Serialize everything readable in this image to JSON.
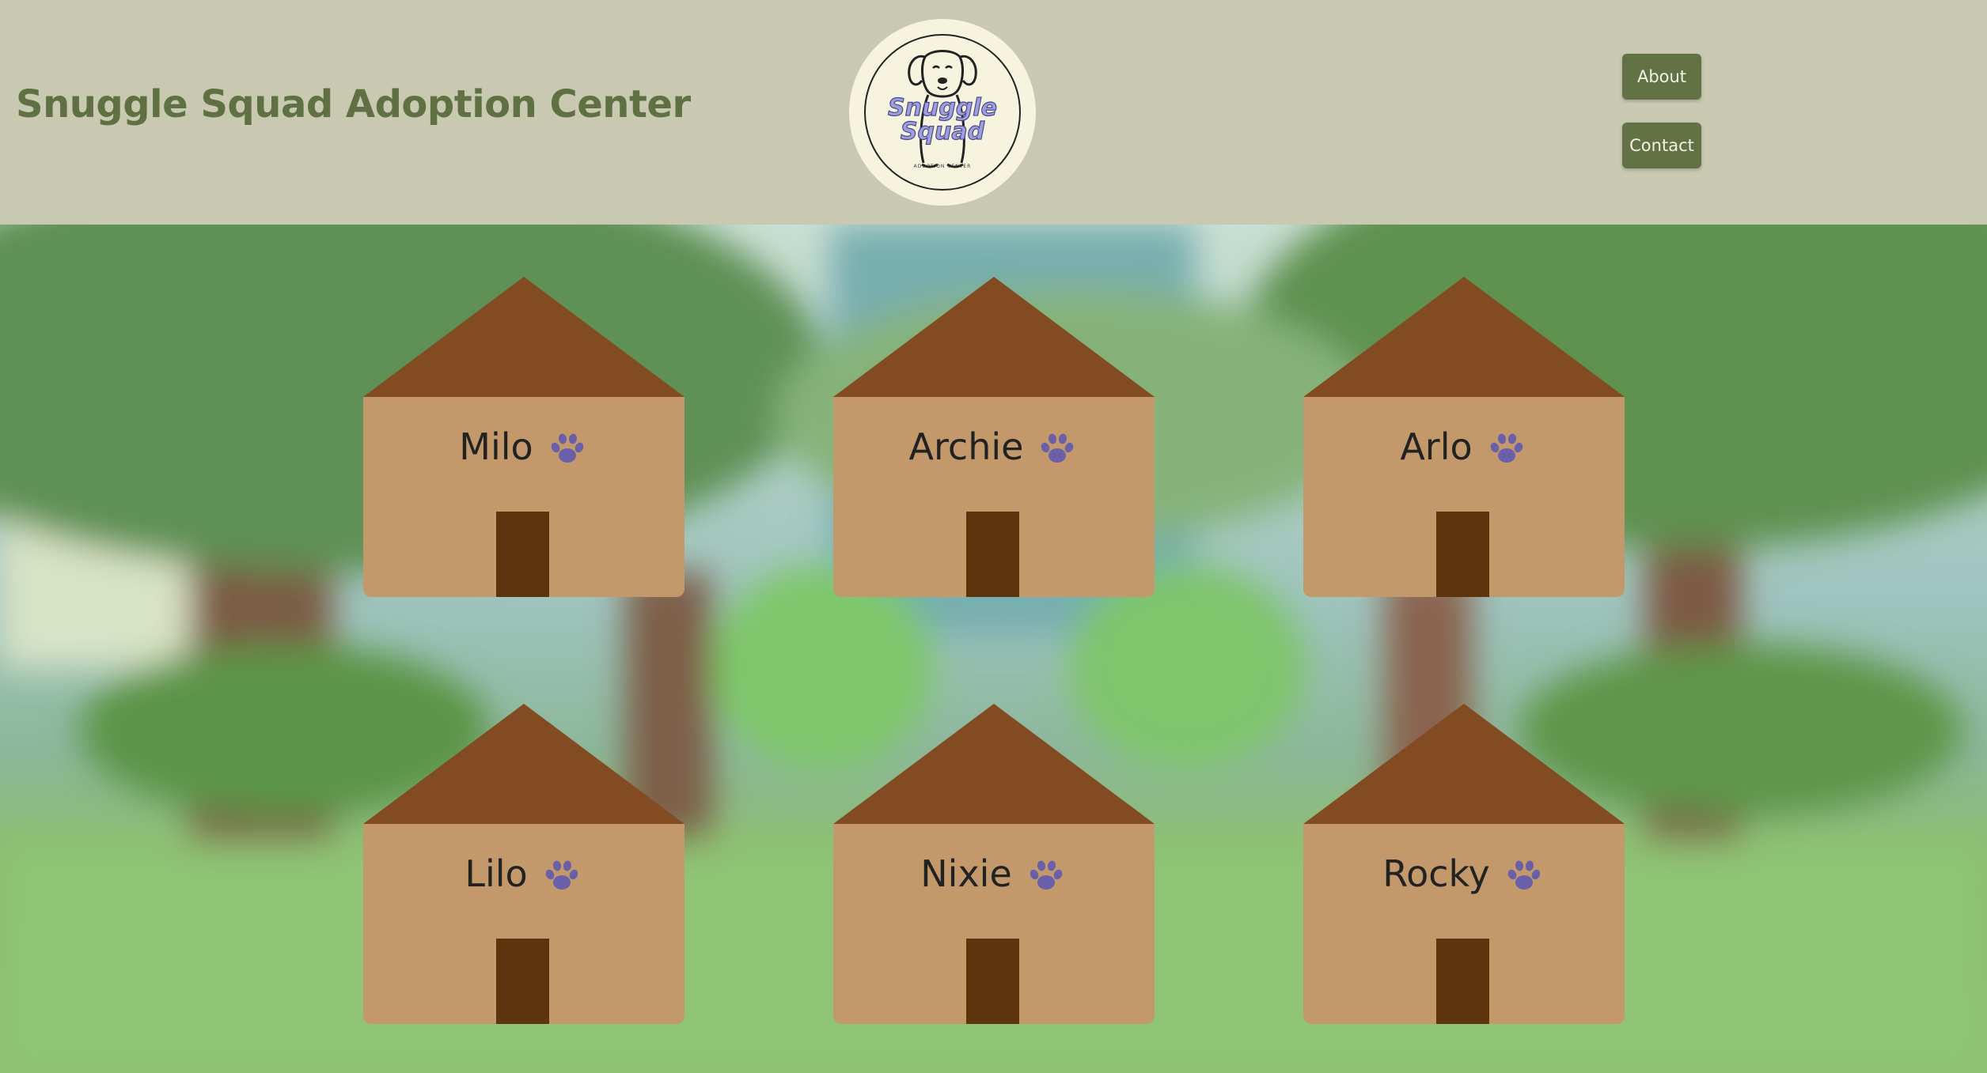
{
  "header": {
    "title": "Snuggle Squad Adoption Center",
    "logo": {
      "icon": "dog-logo-icon",
      "text_line1": "Snuggle",
      "text_line2": "Squad",
      "subtext": "ADOPTION CENTER"
    },
    "nav": [
      {
        "label": "About"
      },
      {
        "label": "Contact"
      }
    ]
  },
  "houses": [
    {
      "name": "Milo",
      "icon": "paw-icon"
    },
    {
      "name": "Archie",
      "icon": "paw-icon"
    },
    {
      "name": "Arlo",
      "icon": "paw-icon"
    },
    {
      "name": "Lilo",
      "icon": "paw-icon"
    },
    {
      "name": "Nixie",
      "icon": "paw-icon"
    },
    {
      "name": "Rocky",
      "icon": "paw-icon"
    }
  ],
  "colors": {
    "header_bg": "#c9c9b1",
    "title": "#5f7143",
    "button_bg": "#637245",
    "roof": "#834b21",
    "house_body": "#c3996b",
    "door": "#5e340f",
    "paw": "#6a5fa8"
  }
}
